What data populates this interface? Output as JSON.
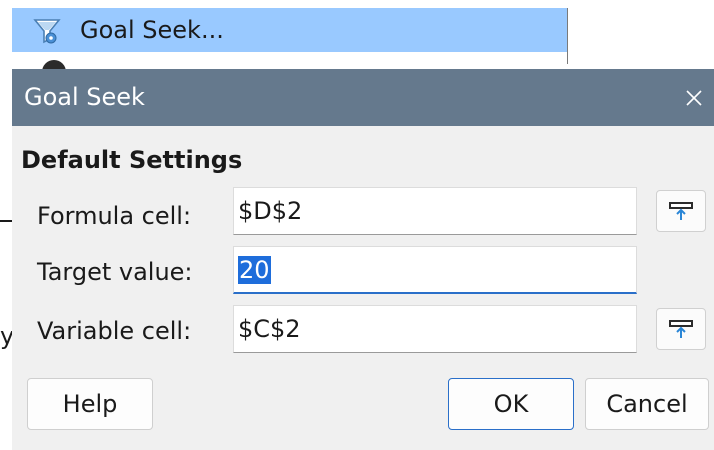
{
  "menu": {
    "item_label": "Goal Seek...",
    "item_icon": "goal-seek-funnel-icon",
    "highlight_color": "#99c9ff"
  },
  "dialog": {
    "title": "Goal Seek",
    "close_icon": "close-icon",
    "titlebar_color": "#65798d",
    "section_title": "Default Settings",
    "formula_cell_label": "Formula cell:",
    "formula_cell_value": "$D$2",
    "target_value_label": "Target value:",
    "target_value_value": "20",
    "variable_cell_label": "Variable cell:",
    "variable_cell_value": "$C$2",
    "shrink_icon": "shrink-reference-icon",
    "accent_color": "#2a6fc9",
    "selection_color": "#1e6ddb"
  },
  "buttons": {
    "help": "Help",
    "ok": "OK",
    "cancel": "Cancel"
  },
  "edge": {
    "arrow_icon": "arrow-right-icon",
    "clipped_char": "y"
  }
}
